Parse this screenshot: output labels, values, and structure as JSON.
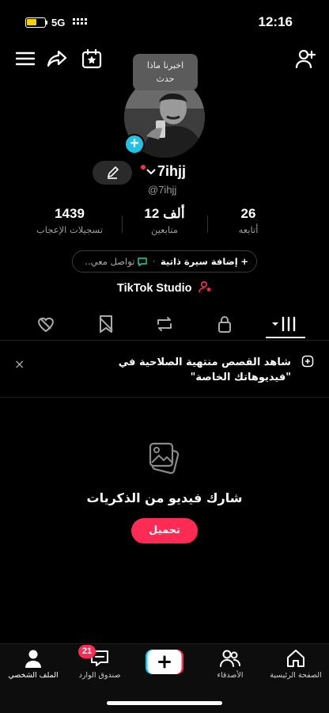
{
  "status_bar": {
    "time": "12:16",
    "network": "5G",
    "battery_level": 0.55
  },
  "header": {
    "menu_icon": "hamburger-menu-icon",
    "share_icon": "share-arrow-icon",
    "calendar_icon": "calendar-star-icon",
    "add_friend_icon": "add-person-icon"
  },
  "tooltip": {
    "line1": "اخبرنا ماذا",
    "line2": "حدث"
  },
  "profile": {
    "username": "7ihjj",
    "handle": "@7ihjj",
    "add_badge": "+"
  },
  "stats": [
    {
      "value": "1439",
      "label": "تسجيلات الإعجاب"
    },
    {
      "value": "12 ألف",
      "label": "متابعين"
    },
    {
      "value": "26",
      "label": "أتابعه"
    }
  ],
  "bio": {
    "add_label": "إضافة سيرة ذاتية",
    "separator": "·",
    "contact_label": "تواصل معي.."
  },
  "studio": {
    "label": "TikTok Studio"
  },
  "tabs": [
    {
      "name": "videos",
      "icon": "grid-icon"
    },
    {
      "name": "private",
      "icon": "lock-icon"
    },
    {
      "name": "reposts",
      "icon": "repost-icon"
    },
    {
      "name": "favorites",
      "icon": "bookmark-icon"
    },
    {
      "name": "liked",
      "icon": "heart-icon"
    }
  ],
  "notice": {
    "text": "شاهد القصص منتهية الصلاحية في \"فيديوهاتك الخاصة\"",
    "close": "×"
  },
  "empty_state": {
    "title": "شارك فيديو من الذكريات",
    "button": "تحميل"
  },
  "bottom_nav": {
    "home": "الصفحة الرئيسية",
    "friends": "الأصدقاء",
    "inbox": "صندوق الوارد",
    "inbox_badge": "21",
    "profile": "الملف الشخصي"
  },
  "colors": {
    "accent": "#fe2c55",
    "cyan": "#20c3e5",
    "green": "#20d5a6",
    "background": "#000000"
  }
}
